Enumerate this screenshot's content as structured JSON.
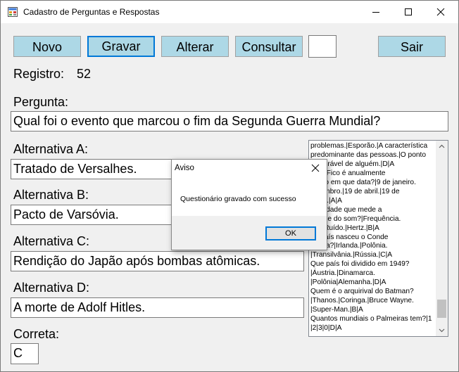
{
  "window": {
    "title": "Cadastro de Perguntas e Respostas"
  },
  "toolbar": {
    "novo": "Novo",
    "gravar": "Gravar",
    "alterar": "Alterar",
    "consultar": "Consultar",
    "consultar_value": "",
    "sair": "Sair"
  },
  "registro": {
    "label": "Registro:",
    "value": "52"
  },
  "pergunta": {
    "label": "Pergunta:",
    "value": "Qual foi o evento que marcou o fim da Segunda Guerra Mundial?"
  },
  "alternativas": {
    "a": {
      "label": "Alternativa A:",
      "value": "Tratado de Versalhes."
    },
    "b": {
      "label": "Alternativa B:",
      "value": "Pacto de Varsóvia."
    },
    "c": {
      "label": "Alternativa C:",
      "value": "Rendição do Japão após bombas atômicas."
    },
    "d": {
      "label": "Alternativa D:",
      "value": "A morte de Adolf Hitles."
    }
  },
  "correta": {
    "label": "Correta:",
    "value": "C"
  },
  "list_lines": [
    "problemas.|Esporão.|A característica",
    "predominante das pessoas.|O ponto",
    "     vulnerável de alguém.|D|A",
    "     a do Fico é anualmente",
    "     orado em que data?|9 de janeiro.",
    "     setembro.|19 de abril.|19 de",
    "     mbro.|A|A",
    "     a unidade que mede a",
    "     sidade do som?|Frequência.",
    "     bel.|Ruído.|Hertz.|B|A",
    "     ue país nasceu o Conde",
    "     rácula?|Irlanda.|Polônia.",
    "|Transilvânia.|Rússia.|C|A",
    "Que país foi dividido em 1949?",
    "|Áustria.|Dinamarca.",
    "|Polônia|Alemanha.|D|A",
    "Quem é o arquirival do Batman?",
    "|Thanos.|Coringa.|Bruce Wayne.",
    "|Super-Man.|B|A",
    "Quantos mundiais o Palmeiras tem?|1",
    "|2|3|0|D|A"
  ],
  "dialog": {
    "title": "Aviso",
    "message": "Questionário gravado com sucesso",
    "ok": "OK"
  },
  "colors": {
    "button_bg": "#add8e6",
    "focus_border": "#0078d7"
  }
}
